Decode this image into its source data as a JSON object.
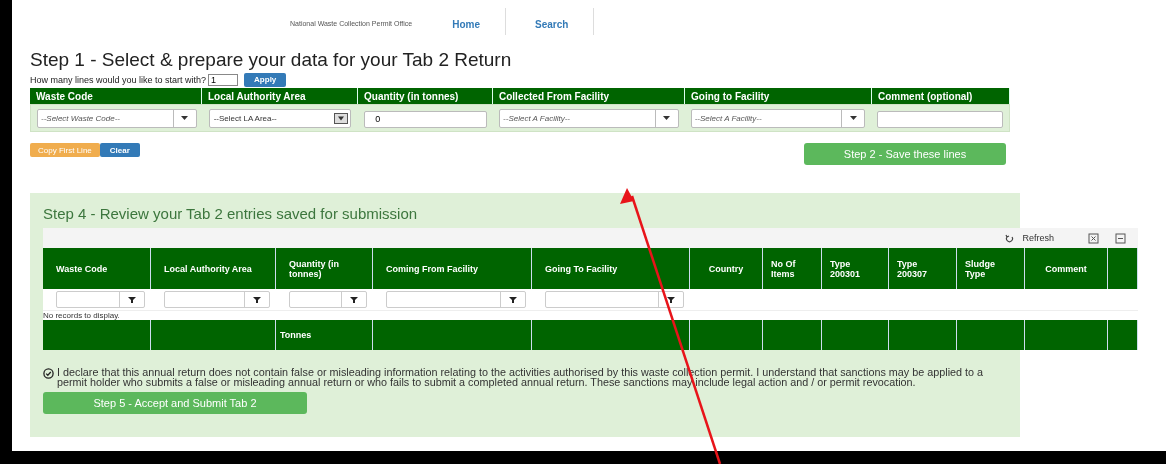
{
  "header": {
    "office": "National Waste Collection Permit Office",
    "nav": [
      {
        "label": "Home"
      },
      {
        "label": "Search"
      }
    ]
  },
  "step1": {
    "title": "Step 1 -  Select & prepare your data for your Tab 2 Return",
    "lines_prompt": "How many lines would you like to start with?",
    "lines_value": "1",
    "apply": "Apply",
    "columns": [
      {
        "label": "Waste Code",
        "kind": "select",
        "placeholder": "--Select Waste Code--"
      },
      {
        "label": "Local Authority Area",
        "kind": "listbox",
        "placeholder": "--Select LA Area--"
      },
      {
        "label": "Quantity (in tonnes)",
        "kind": "text",
        "value": "0"
      },
      {
        "label": "Collected From Facility",
        "kind": "select",
        "placeholder": "--Select A Facility--"
      },
      {
        "label": "Going to Facility",
        "kind": "select",
        "placeholder": "--Select A Facility--"
      },
      {
        "label": "Comment (optional)",
        "kind": "text"
      }
    ],
    "copy_button": "Copy First Line",
    "clear_button": "Clear",
    "save_button": "Step 2 - Save these lines"
  },
  "step4": {
    "title": "Step 4 - Review your Tab 2 entries saved for submission",
    "refresh": "Refresh",
    "columns": [
      {
        "label": "Waste Code",
        "filterable": true
      },
      {
        "label": "Local Authority Area",
        "filterable": true
      },
      {
        "label": "Quantity (in tonnes)",
        "filterable": true,
        "footer": "Tonnes"
      },
      {
        "label": "Coming From Facility",
        "filterable": true
      },
      {
        "label": "Going To Facility",
        "filterable": true
      },
      {
        "label": "Country",
        "filterable": false
      },
      {
        "label": "No Of Items",
        "filterable": false
      },
      {
        "label": "Type 200301",
        "filterable": false
      },
      {
        "label": "Type 200307",
        "filterable": false
      },
      {
        "label": "Sludge Type",
        "filterable": false
      },
      {
        "label": "Comment",
        "filterable": false
      },
      {
        "filterable": false
      }
    ],
    "empty_message": "No records to display.",
    "declaration": {
      "checked": true,
      "text": "I declare that this annual return does not contain false or misleading information relating to the activities authorised by this waste collection permit. I understand that sanctions may be applied to a permit holder who submits a false or misleading annual return or who fails to submit a completed annual return. These sanctions may include legal action and / or permit revocation."
    },
    "submit_button": "Step 5 - Accept and Submit Tab 2"
  }
}
